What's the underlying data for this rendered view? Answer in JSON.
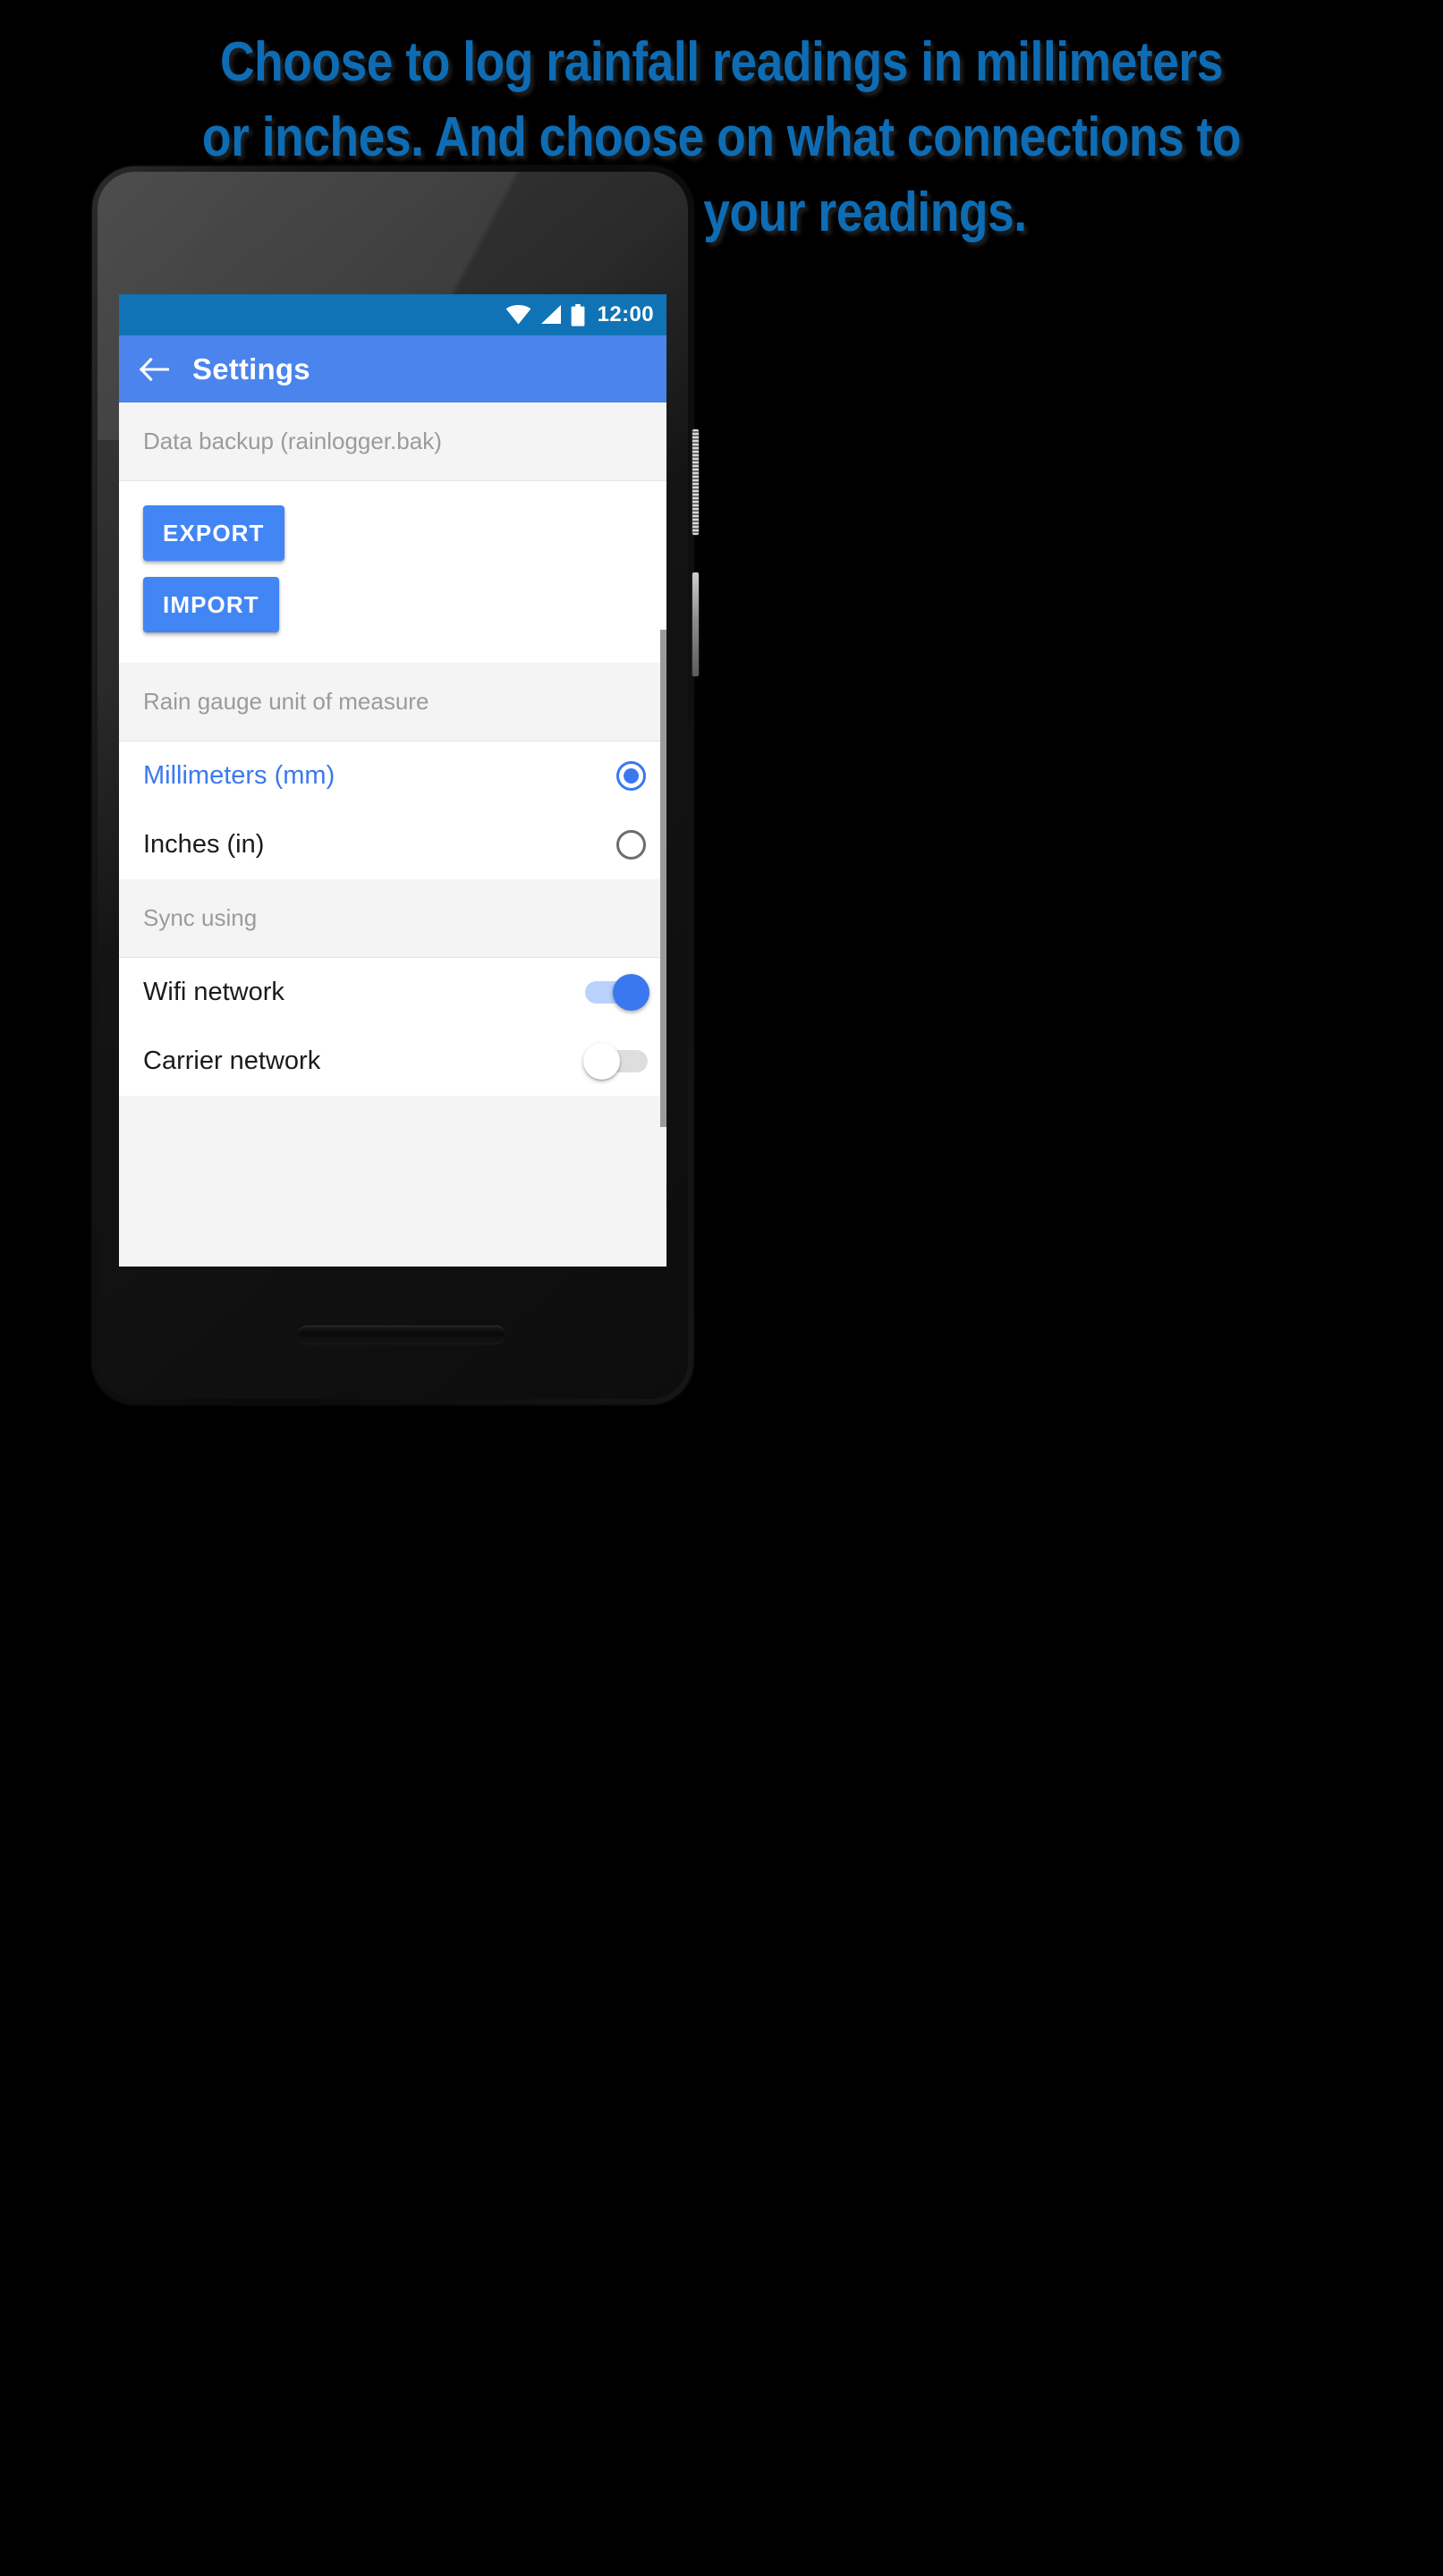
{
  "headline": "Choose to log rainfall readings in millimeters\nor inches. And choose on what connections to\nsynchronize your readings.",
  "colors": {
    "headline_blue": "#0e6cb4",
    "statusbar_blue": "#1073b5",
    "appbar_blue": "#4a84ec",
    "accent_blue": "#4285f4",
    "selected_text_blue": "#3b78f0",
    "section_header_bg": "#f4f4f4",
    "section_header_text": "#9b9b9b",
    "row_text": "#1b1b1b",
    "switch_off_track": "#dedede",
    "switch_on_track": "#b9d2fb",
    "radio_off_border": "#6d6d6d"
  },
  "statusbar": {
    "icons": [
      "wifi-icon",
      "signal-icon",
      "battery-icon"
    ],
    "clock": "12:00"
  },
  "appbar": {
    "back_icon": "arrow-left-icon",
    "title": "Settings"
  },
  "sections": [
    {
      "id": "data-backup",
      "header": "Data backup (rainlogger.bak)",
      "buttons": [
        {
          "id": "export",
          "label": "EXPORT"
        },
        {
          "id": "import",
          "label": "IMPORT"
        }
      ]
    },
    {
      "id": "rain-gauge-unit",
      "header": "Rain gauge unit of measure",
      "options": [
        {
          "id": "millimeters",
          "label": "Millimeters (mm)",
          "selected": true
        },
        {
          "id": "inches",
          "label": "Inches (in)",
          "selected": false
        }
      ]
    },
    {
      "id": "sync-using",
      "header": "Sync using",
      "toggles": [
        {
          "id": "wifi-network",
          "label": "Wifi network",
          "on": true
        },
        {
          "id": "carrier-network",
          "label": "Carrier network",
          "on": false
        }
      ]
    }
  ],
  "device": {
    "top_hardware": [
      "front-camera",
      "earpiece-speaker"
    ],
    "bottom_hardware": [
      "bottom-speaker"
    ],
    "side_hardware": [
      "power-button",
      "volume-rocker"
    ]
  }
}
